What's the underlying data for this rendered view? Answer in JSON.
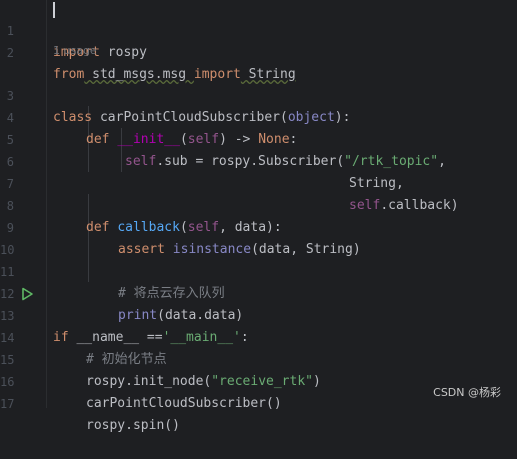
{
  "gutter": {
    "line_numbers": [
      "1",
      "2",
      "3",
      "4",
      "5",
      "6",
      "7",
      "8",
      "9",
      "10",
      "11",
      "12",
      "13",
      "14",
      "15",
      "16",
      "17"
    ]
  },
  "inlay": {
    "usage_hint": "1 usage"
  },
  "code": {
    "l1": {
      "kw": "import",
      "rest": " rospy"
    },
    "l2": {
      "kw1": "from",
      "mod": " std_msgs.msg ",
      "kw2": "import",
      "name": " String"
    },
    "l3": {
      "kw": "class",
      "name": " carPointCloudSubscriber(",
      "base": "object",
      "end": "):"
    },
    "l4": {
      "kw": "def",
      "sp": " ",
      "dunder": "__init__",
      "open": "(",
      "self": "self",
      "close": ") -> ",
      "none": "None",
      "colon": ":"
    },
    "l5": {
      "self": "self",
      "mid": ".sub = rospy.Subscriber(",
      "str": "\"/rtk_topic\"",
      "end": ","
    },
    "l6": {
      "text": "String,"
    },
    "l7": {
      "self": "self",
      "end": ".callback)"
    },
    "l8": {
      "kw": "def",
      "sp": " ",
      "fn": "callback",
      "open": "(",
      "self": "self",
      "end": ", data):"
    },
    "l9": {
      "kw": "assert",
      "sp": " ",
      "builtin": "isinstance",
      "end": "(data, String)"
    },
    "l11": {
      "comment": "# 将点云存入队列"
    },
    "l12": {
      "builtin": "print",
      "end": "(data.data)"
    },
    "l13": {
      "kw": "if",
      "mid": " __name__ ==",
      "str": "'__main__'",
      "end": ":"
    },
    "l14": {
      "comment": "# 初始化节点"
    },
    "l15": {
      "pre": "rospy.init_node(",
      "str": "\"receive_rtk\"",
      "end": ")"
    },
    "l16": {
      "text": "carPointCloudSubscriber()"
    },
    "l17": {
      "text": "rospy.spin()"
    }
  },
  "icons": {
    "run": "run-triangle-icon"
  },
  "watermark": {
    "text": "CSDN @杨彩"
  },
  "colors": {
    "background": "#1e1f22",
    "keyword": "#cf8e6d",
    "string": "#6aab73",
    "function": "#56a8f5",
    "self": "#94558d",
    "comment": "#7a7e85",
    "run_icon": "#5fb865"
  }
}
